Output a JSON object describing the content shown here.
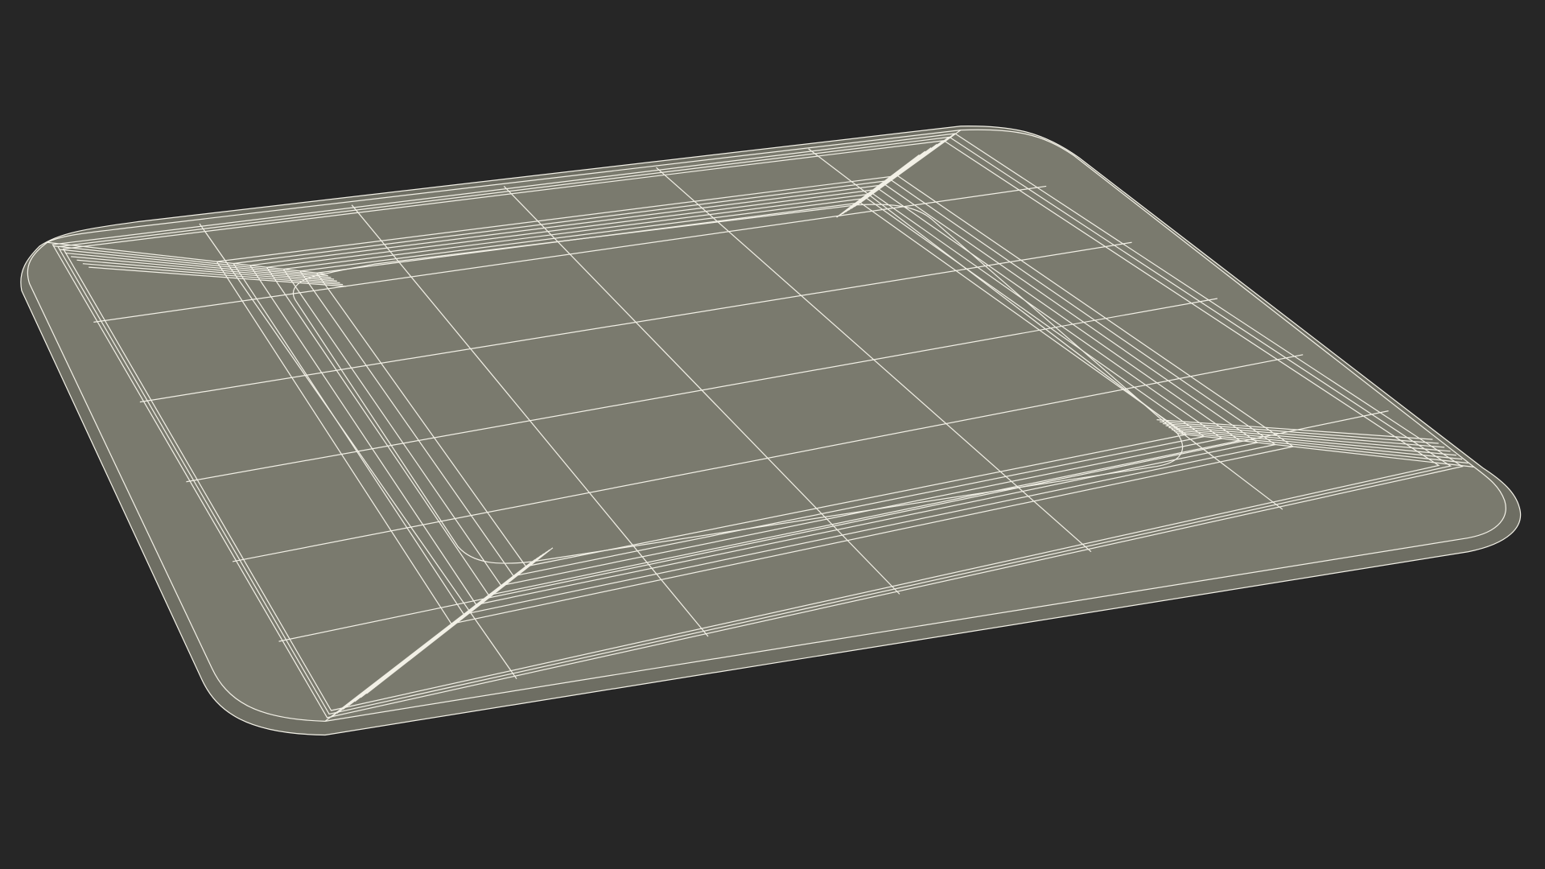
{
  "scene": {
    "subject": "wireframe-square-plate",
    "background_color": "#262626",
    "surface_color": "#7a7a6e",
    "wire_color": "#f2f0e6"
  }
}
